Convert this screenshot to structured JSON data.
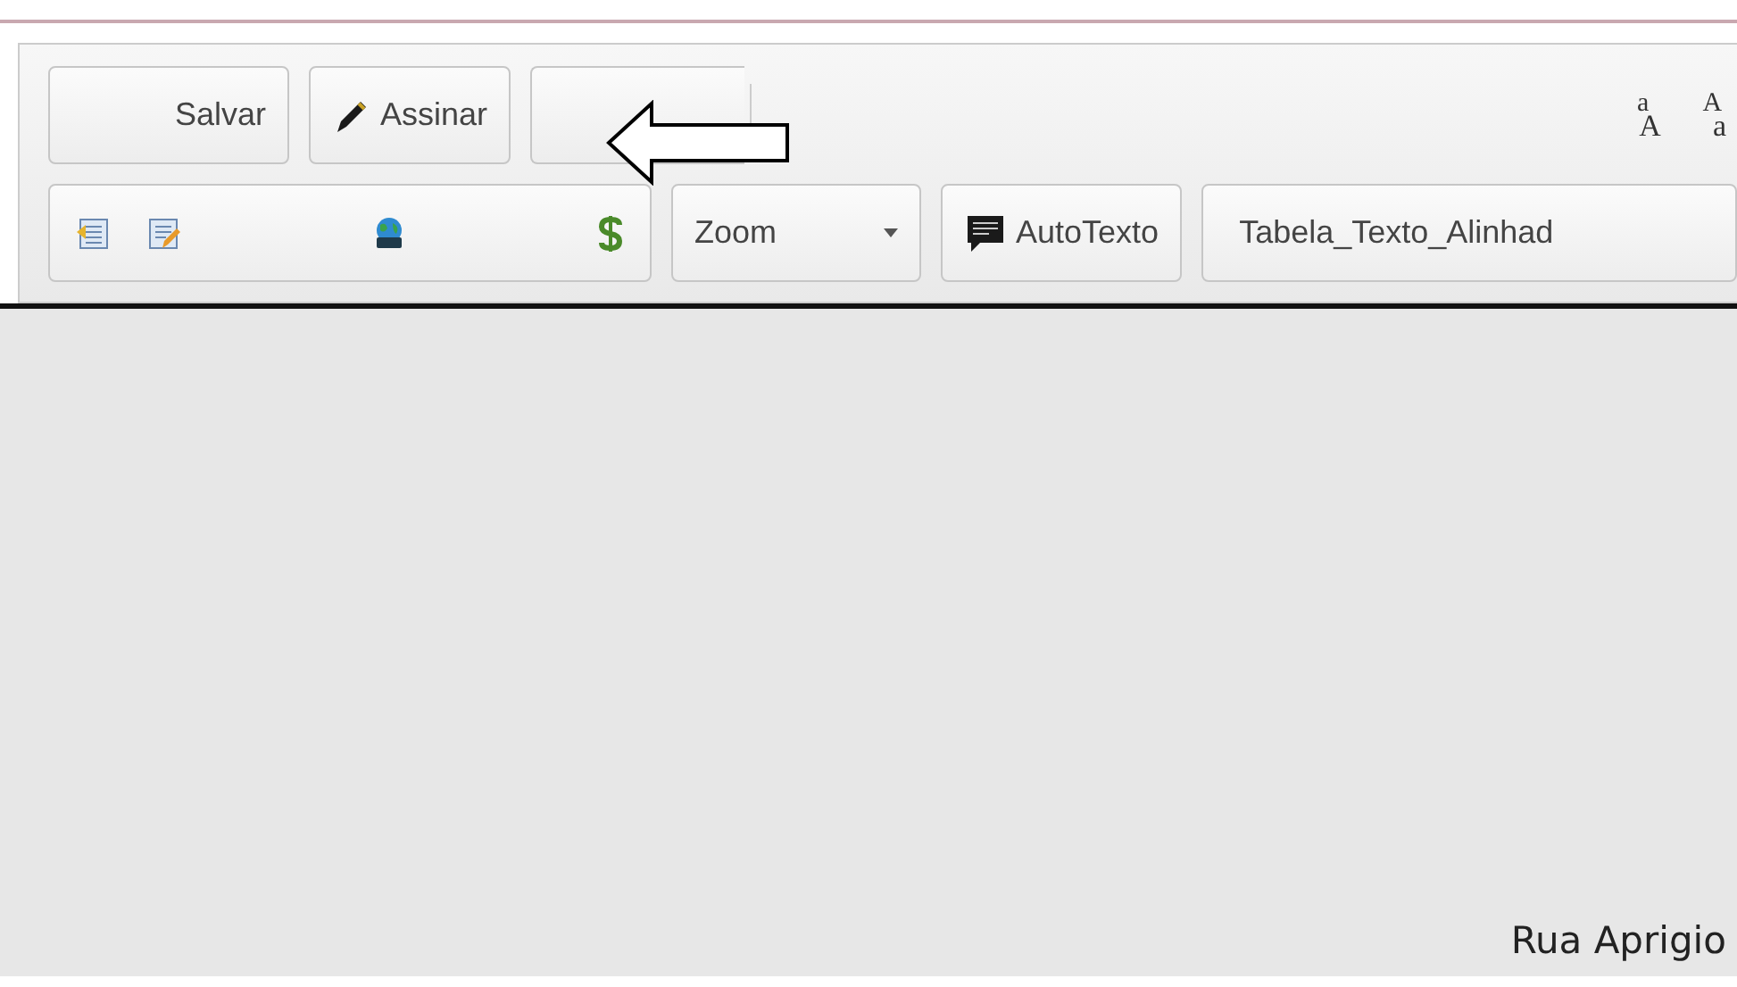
{
  "toolbar": {
    "row_1": {
      "buttons": [
        {
          "label": "Salvar",
          "kind": "text"
        },
        {
          "label": "Assinar",
          "kind": "pen"
        }
      ],
      "case_buttons": [
        {
          "top": "a",
          "bottom": "A"
        },
        {
          "top": "A",
          "bottom": "a"
        }
      ]
    },
    "row_2": {
      "zoom": {
        "label": "Zoom"
      },
      "autotext": {
        "label": "AutoTexto"
      },
      "style_field": {
        "value": "Tabela_Texto_Alinhad"
      }
    }
  },
  "document": {
    "text": "Rua Aprigio"
  }
}
